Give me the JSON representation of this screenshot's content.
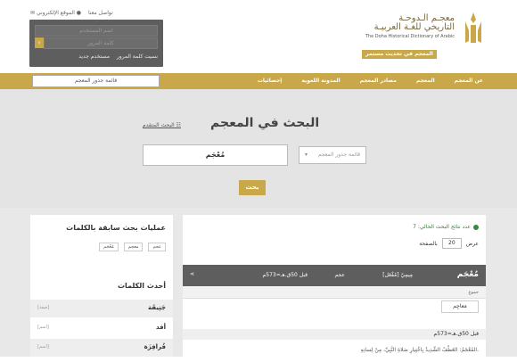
{
  "header": {
    "top_links": {
      "main_site": "الموقع الإلكتروني",
      "contact": "تواصل معنا"
    },
    "login": {
      "username_placeholder": "اسم المستخدم",
      "password_placeholder": "كلمة المرور",
      "forgot": "نسيت كلمة المرور",
      "new_user": "مستخدم جديد"
    },
    "logo": {
      "title_line1": "معجـم الـدوحـة",
      "title_line2": "التاريخي للغـة العربيـة",
      "subtitle": "The Doha Historical Dictionary of Arabic",
      "badge": "المعجم في تحديث مستمر"
    }
  },
  "nav": {
    "roots_button": "قائمة جذور المعجم",
    "items": [
      "عن المعجم",
      "المعجم",
      "مصادر المعجم",
      "المدونة اللغوية",
      "إحصائيات"
    ]
  },
  "search": {
    "title": "البحث في المعجم",
    "advanced": "البحث المتقدم",
    "roots_select": "قائمة جذور المعجم",
    "query": "مُعْجَم",
    "button": "بحث"
  },
  "results": {
    "count_label": "عدد نتائج البحث الحالي: 7",
    "show_label": "عرض",
    "per_page_value": "20",
    "per_page_suffix": "بالصفحة",
    "head_word": "مُعْجَم",
    "head_type": "[مُفْعَل] مِيمِيّ",
    "head_root": "عجم",
    "head_date": "قبل 50ق.هـ=573م",
    "plural_label": "جموع",
    "plural_value": "مَعاجِم",
    "era_label": "قبل 50ق.هـ=573م",
    "example": "المُعْجَمُ: العَطْفُ الشَّدِيدُ بِاخْتِيارِ صَلاةِ النَّبِيِّ، مِنْ لِسانِهِ."
  },
  "sidebar": {
    "prev_title": "عمليات بحث سابقة بالكلمات",
    "prev_ops": [
      "عجم",
      "معجم",
      "مُعْجَم"
    ],
    "latest_title": "أحدث الكلمات",
    "latest": [
      {
        "word": "جَنِيقَة",
        "tag": "[صفة]"
      },
      {
        "word": "أفد",
        "tag": "[اسم]"
      },
      {
        "word": "فُرافِزَة",
        "tag": "[اسم]"
      }
    ]
  },
  "colors": {
    "gold": "#c9a84a",
    "dark_gray": "#5e5e5e",
    "search_bg": "#e4e4e4"
  }
}
